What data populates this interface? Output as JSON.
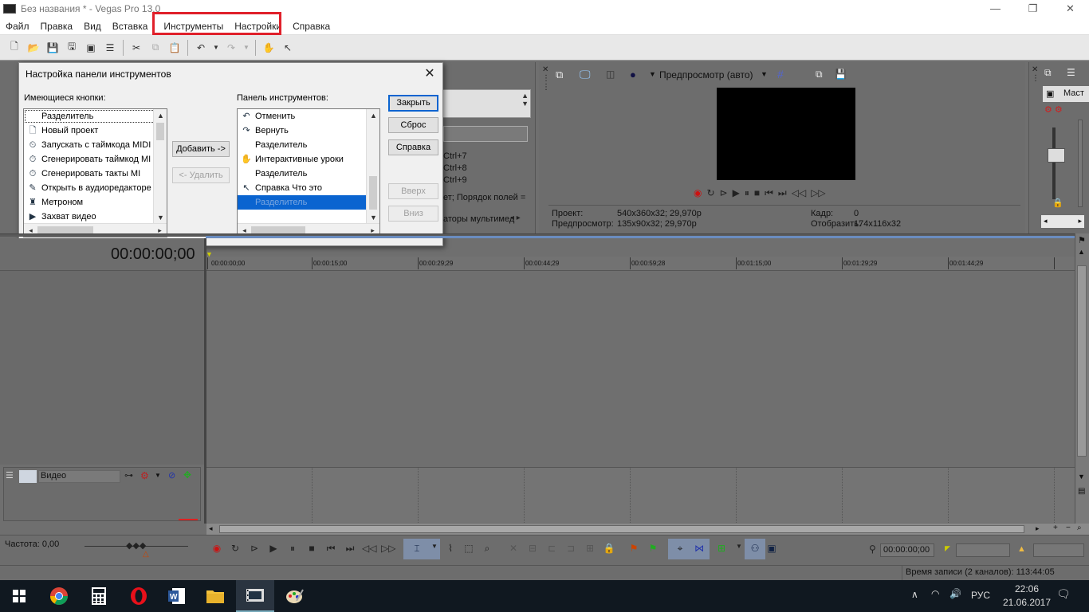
{
  "window": {
    "title": "Без названия * - Vegas Pro 13.0",
    "controls": {
      "minimize": "—",
      "restore": "❐",
      "close": "✕"
    }
  },
  "menu": [
    "Файл",
    "Правка",
    "Вид",
    "Вставка",
    "Инструменты",
    "Настройки",
    "Справка"
  ],
  "colors": {
    "highlight": "#e0202a",
    "selection": "#0a64d0"
  },
  "left_panel": {
    "shortcuts": [
      "Ctrl+7",
      "Ctrl+8",
      "Ctrl+9"
    ],
    "order_text": "ет; Порядок полей =",
    "tab_text": "аторы мультимед"
  },
  "preview": {
    "mode": "Предпросмотр (авто)",
    "project_label": "Проект:",
    "project_value": "540x360x32; 29,970p",
    "preview_label": "Предпросмотр:",
    "preview_value": "135x90x32; 29,970p",
    "frame_label": "Кадр:",
    "frame_value": "0",
    "display_label": "Отобразить:",
    "display_value": "174x116x32"
  },
  "mixer": {
    "label": "Маст"
  },
  "dialog": {
    "title": "Настройка панели инструментов",
    "available_label": "Имеющиеся кнопки:",
    "toolbar_label": "Панель инструментов:",
    "available_items": [
      {
        "label": "Разделитель",
        "icon": ""
      },
      {
        "label": "Новый проект",
        "icon": "new-project-icon"
      },
      {
        "label": "Запускать с таймкода MIDI",
        "icon": "midi-timecode-icon"
      },
      {
        "label": "Сгенерировать таймкод MI",
        "icon": "generate-timecode-icon"
      },
      {
        "label": "Сгенерировать такты MI",
        "icon": "generate-beats-icon"
      },
      {
        "label": "Открыть в аудиоредакторе",
        "icon": "audio-editor-icon"
      },
      {
        "label": "Метроном",
        "icon": "metronome-icon"
      },
      {
        "label": "Захват видео",
        "icon": "video-capture-icon"
      }
    ],
    "toolbar_items": [
      {
        "label": "Отменить",
        "icon": "undo-icon"
      },
      {
        "label": "Вернуть",
        "icon": "redo-icon"
      },
      {
        "label": "Разделитель",
        "icon": ""
      },
      {
        "label": "Интерактивные уроки",
        "icon": "tutorials-icon"
      },
      {
        "label": "Разделитель",
        "icon": ""
      },
      {
        "label": "Справка Что это",
        "icon": "whats-this-icon"
      },
      {
        "label": "Разделитель",
        "icon": ""
      }
    ],
    "add_button": "Добавить ->",
    "remove_button": "<- Удалить",
    "close_button": "Закрыть",
    "reset_button": "Сброс",
    "help_button": "Справка",
    "up_button": "Вверх",
    "down_button": "Вниз"
  },
  "timeline": {
    "timecode": "00:00:00;00",
    "ruler": [
      "00:00:00;00",
      "00:00:15;00",
      "00:00:29;29",
      "00:00:44;29",
      "00:00:59;28",
      "00:01:15;00",
      "00:01:29;29",
      "00:01:44;29"
    ]
  },
  "track": {
    "name": "Видео"
  },
  "status": {
    "rate": "Частота: 0,00",
    "cursor_time": "00:00:00;00",
    "record_time": "Время записи (2 каналов): 113:44:05"
  },
  "taskbar": {
    "language": "РУС",
    "time": "22:06",
    "date": "21.06.2017"
  }
}
